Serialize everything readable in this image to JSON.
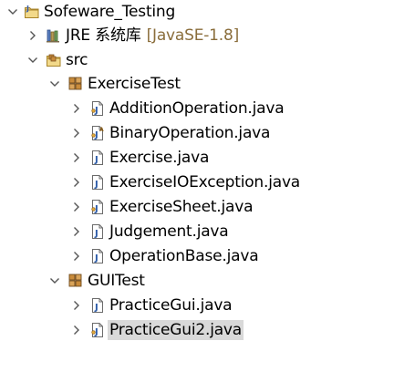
{
  "explorer": {
    "project": {
      "name": "Sofeware_Testing",
      "expanded": true
    },
    "jre": {
      "name": "JRE 系统库",
      "decoration": "[JavaSE-1.8]",
      "expanded": false
    },
    "src": {
      "name": "src",
      "expanded": true
    },
    "packages": [
      {
        "name": "ExerciseTest",
        "expanded": true,
        "files": [
          {
            "name": "AdditionOperation.java",
            "icon": "java-class-file-icon"
          },
          {
            "name": "BinaryOperation.java",
            "icon": "java-abstract-class-file-icon"
          },
          {
            "name": "Exercise.java",
            "icon": "java-class-file-icon"
          },
          {
            "name": "ExerciseIOException.java",
            "icon": "java-class-file-icon"
          },
          {
            "name": "ExerciseSheet.java",
            "icon": "java-class-file-icon"
          },
          {
            "name": "Judgement.java",
            "icon": "java-class-file-icon"
          },
          {
            "name": "OperationBase.java",
            "icon": "java-class-file-icon"
          }
        ]
      },
      {
        "name": "GUITest",
        "expanded": true,
        "files": [
          {
            "name": "PracticeGui.java",
            "icon": "java-class-file-icon"
          },
          {
            "name": "PracticeGui2.java",
            "icon": "java-class-file-icon",
            "selected": true
          }
        ]
      }
    ]
  },
  "colors": {
    "selection": "#d9d9d9",
    "decoration": "#8a6d3b",
    "chevron": "#555555"
  }
}
